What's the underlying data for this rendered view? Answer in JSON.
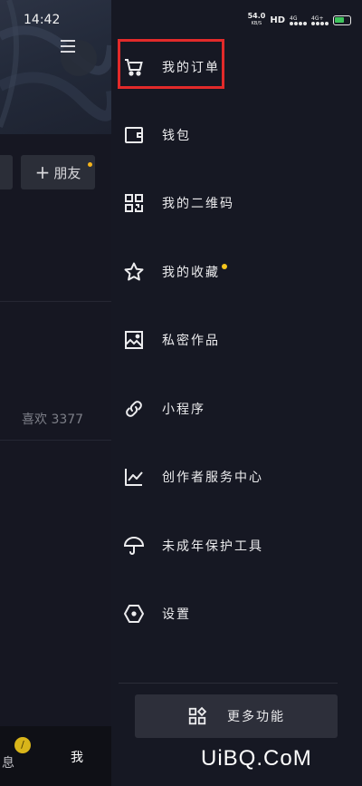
{
  "status": {
    "time": "14:42",
    "speed_value": "54.0",
    "speed_unit": "KB/S",
    "hd": "HD",
    "net1": "4G",
    "net2": "4G+"
  },
  "profile": {
    "add_friend_label": "朋友",
    "likes_text": "喜欢 3377",
    "tab_message": "息",
    "tab_me": "我",
    "message_badge": "/"
  },
  "drawer": {
    "items": [
      {
        "label": "我的订单",
        "icon": "cart-icon"
      },
      {
        "label": "钱包",
        "icon": "wallet-icon"
      },
      {
        "label": "我的二维码",
        "icon": "qrcode-icon"
      },
      {
        "label": "我的收藏",
        "icon": "star-icon",
        "has_dot": true
      },
      {
        "label": "私密作品",
        "icon": "image-icon"
      },
      {
        "label": "小程序",
        "icon": "link-icon"
      },
      {
        "label": "创作者服务中心",
        "icon": "chart-icon"
      },
      {
        "label": "未成年保护工具",
        "icon": "umbrella-icon"
      },
      {
        "label": "设置",
        "icon": "hexagon-icon"
      }
    ],
    "more_label": "更多功能"
  },
  "watermark": "UiBQ.CoM",
  "colors": {
    "highlight": "#e22a2a",
    "dot": "#f5c51d",
    "background": "#161823"
  }
}
